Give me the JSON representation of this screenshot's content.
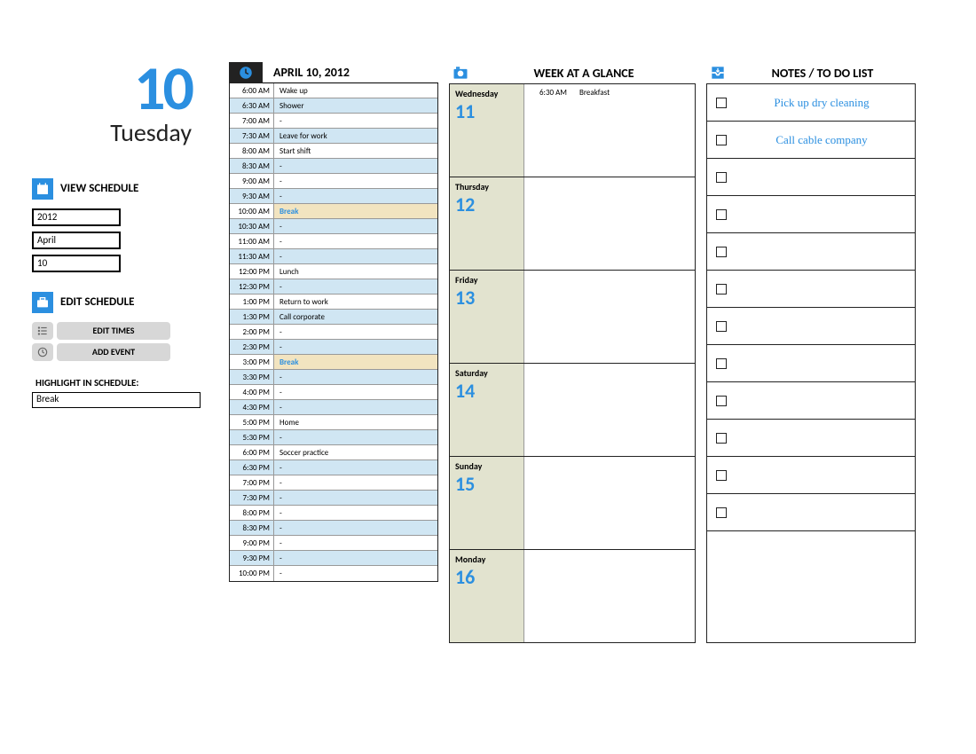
{
  "header": {
    "date_number": "10",
    "day_name": "Tuesday"
  },
  "sidebar": {
    "view_label": "VIEW SCHEDULE",
    "year_value": "2012",
    "month_value": "April",
    "day_value": "10",
    "edit_label": "EDIT SCHEDULE",
    "btn_edit_times": "EDIT TIMES",
    "btn_add_event": "ADD EVENT",
    "highlight_label": "HIGHLIGHT IN SCHEDULE:",
    "highlight_value": "Break"
  },
  "daily": {
    "title": "APRIL 10, 2012",
    "slots": [
      {
        "time": "6:00 AM",
        "event": "Wake up",
        "alt": false,
        "hl": false
      },
      {
        "time": "6:30 AM",
        "event": "Shower",
        "alt": true,
        "hl": false
      },
      {
        "time": "7:00 AM",
        "event": "-",
        "alt": false,
        "hl": false
      },
      {
        "time": "7:30 AM",
        "event": "Leave for work",
        "alt": true,
        "hl": false
      },
      {
        "time": "8:00 AM",
        "event": "Start shift",
        "alt": false,
        "hl": false
      },
      {
        "time": "8:30 AM",
        "event": "-",
        "alt": true,
        "hl": false
      },
      {
        "time": "9:00 AM",
        "event": "-",
        "alt": false,
        "hl": false
      },
      {
        "time": "9:30 AM",
        "event": "-",
        "alt": true,
        "hl": false
      },
      {
        "time": "10:00 AM",
        "event": "Break",
        "alt": false,
        "hl": true
      },
      {
        "time": "10:30 AM",
        "event": "-",
        "alt": true,
        "hl": false
      },
      {
        "time": "11:00 AM",
        "event": "-",
        "alt": false,
        "hl": false
      },
      {
        "time": "11:30 AM",
        "event": "-",
        "alt": true,
        "hl": false
      },
      {
        "time": "12:00 PM",
        "event": "Lunch",
        "alt": false,
        "hl": false
      },
      {
        "time": "12:30 PM",
        "event": "-",
        "alt": true,
        "hl": false
      },
      {
        "time": "1:00 PM",
        "event": "Return to work",
        "alt": false,
        "hl": false
      },
      {
        "time": "1:30 PM",
        "event": "Call corporate",
        "alt": true,
        "hl": false
      },
      {
        "time": "2:00 PM",
        "event": "-",
        "alt": false,
        "hl": false
      },
      {
        "time": "2:30 PM",
        "event": "-",
        "alt": true,
        "hl": false
      },
      {
        "time": "3:00 PM",
        "event": "Break",
        "alt": false,
        "hl": true
      },
      {
        "time": "3:30 PM",
        "event": "-",
        "alt": true,
        "hl": false
      },
      {
        "time": "4:00 PM",
        "event": "-",
        "alt": false,
        "hl": false
      },
      {
        "time": "4:30 PM",
        "event": "-",
        "alt": true,
        "hl": false
      },
      {
        "time": "5:00 PM",
        "event": "Home",
        "alt": false,
        "hl": false
      },
      {
        "time": "5:30 PM",
        "event": "-",
        "alt": true,
        "hl": false
      },
      {
        "time": "6:00 PM",
        "event": "Soccer practice",
        "alt": false,
        "hl": false
      },
      {
        "time": "6:30 PM",
        "event": "-",
        "alt": true,
        "hl": false
      },
      {
        "time": "7:00 PM",
        "event": "-",
        "alt": false,
        "hl": false
      },
      {
        "time": "7:30 PM",
        "event": "-",
        "alt": true,
        "hl": false
      },
      {
        "time": "8:00 PM",
        "event": "-",
        "alt": false,
        "hl": false
      },
      {
        "time": "8:30 PM",
        "event": "-",
        "alt": true,
        "hl": false
      },
      {
        "time": "9:00 PM",
        "event": "-",
        "alt": false,
        "hl": false
      },
      {
        "time": "9:30 PM",
        "event": "-",
        "alt": true,
        "hl": false
      },
      {
        "time": "10:00 PM",
        "event": "-",
        "alt": false,
        "hl": false
      }
    ]
  },
  "week": {
    "title": "WEEK AT A GLANCE",
    "days": [
      {
        "name": "Wednesday",
        "num": "11",
        "events": [
          {
            "time": "6:30 AM",
            "label": "Breakfast"
          }
        ]
      },
      {
        "name": "Thursday",
        "num": "12",
        "events": []
      },
      {
        "name": "Friday",
        "num": "13",
        "events": []
      },
      {
        "name": "Saturday",
        "num": "14",
        "events": []
      },
      {
        "name": "Sunday",
        "num": "15",
        "events": []
      },
      {
        "name": "Monday",
        "num": "16",
        "events": []
      }
    ]
  },
  "notes": {
    "title": "NOTES / TO DO LIST",
    "items": [
      {
        "text": "Pick up dry cleaning"
      },
      {
        "text": "Call cable company"
      },
      {
        "text": ""
      },
      {
        "text": ""
      },
      {
        "text": ""
      },
      {
        "text": ""
      },
      {
        "text": ""
      },
      {
        "text": ""
      },
      {
        "text": ""
      },
      {
        "text": ""
      },
      {
        "text": ""
      },
      {
        "text": ""
      }
    ]
  }
}
